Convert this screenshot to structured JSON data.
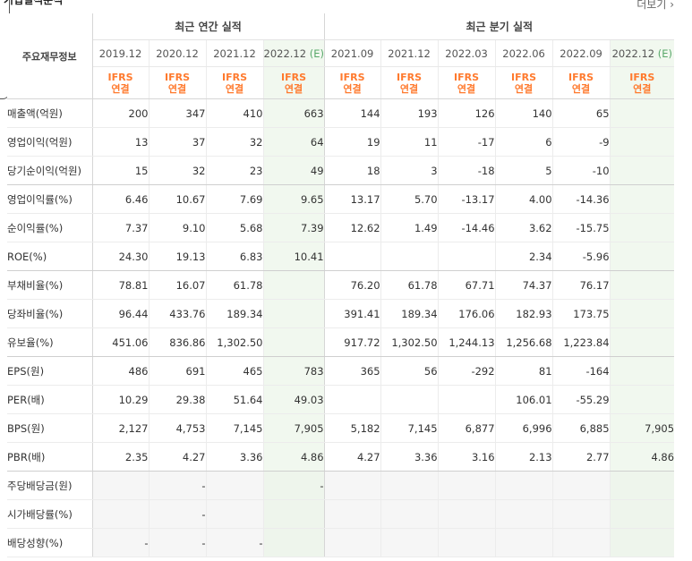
{
  "header": {
    "title": "기업실적분석",
    "more": "더보기",
    "item_header": "주요재무정보",
    "annual_header": "최근 연간 실적",
    "quarter_header": "최근 분기 실적",
    "estimate_mark": "(E)"
  },
  "periods": [
    {
      "date": "2019.12",
      "est": false,
      "l1": "IFRS",
      "l2": "연결"
    },
    {
      "date": "2020.12",
      "est": false,
      "l1": "IFRS",
      "l2": "연결"
    },
    {
      "date": "2021.12",
      "est": false,
      "l1": "IFRS",
      "l2": "연결"
    },
    {
      "date": "2022.12",
      "est": true,
      "l1": "IFRS",
      "l2": "연결"
    },
    {
      "date": "2021.09",
      "est": false,
      "l1": "IFRS",
      "l2": "연결"
    },
    {
      "date": "2021.12",
      "est": false,
      "l1": "IFRS",
      "l2": "연결"
    },
    {
      "date": "2022.03",
      "est": false,
      "l1": "IFRS",
      "l2": "연결"
    },
    {
      "date": "2022.06",
      "est": false,
      "l1": "IFRS",
      "l2": "연결"
    },
    {
      "date": "2022.09",
      "est": false,
      "l1": "IFRS",
      "l2": "연결"
    },
    {
      "date": "2022.12",
      "est": true,
      "l1": "IFRS",
      "l2": "연결"
    }
  ],
  "rows": [
    {
      "label": "매출액(억원)",
      "values": [
        "200",
        "347",
        "410",
        "663",
        "144",
        "193",
        "126",
        "140",
        "65",
        ""
      ]
    },
    {
      "label": "영업이익(억원)",
      "values": [
        "13",
        "37",
        "32",
        "64",
        "19",
        "11",
        "-17",
        "6",
        "-9",
        ""
      ]
    },
    {
      "label": "당기순이익(억원)",
      "values": [
        "15",
        "32",
        "23",
        "49",
        "18",
        "3",
        "-18",
        "5",
        "-10",
        ""
      ],
      "group_end": true
    },
    {
      "label": "영업이익률(%)",
      "values": [
        "6.46",
        "10.67",
        "7.69",
        "9.65",
        "13.17",
        "5.70",
        "-13.17",
        "4.00",
        "-14.36",
        ""
      ]
    },
    {
      "label": "순이익률(%)",
      "values": [
        "7.37",
        "9.10",
        "5.68",
        "7.39",
        "12.62",
        "1.49",
        "-14.46",
        "3.62",
        "-15.75",
        ""
      ]
    },
    {
      "label": "ROE(%)",
      "values": [
        "24.30",
        "19.13",
        "6.83",
        "10.41",
        "",
        "",
        "",
        "2.34",
        "-5.96",
        ""
      ],
      "group_end": true
    },
    {
      "label": "부채비율(%)",
      "values": [
        "78.81",
        "16.07",
        "61.78",
        "",
        "76.20",
        "61.78",
        "67.71",
        "74.37",
        "76.17",
        ""
      ]
    },
    {
      "label": "당좌비율(%)",
      "values": [
        "96.44",
        "433.76",
        "189.34",
        "",
        "391.41",
        "189.34",
        "176.06",
        "182.93",
        "173.75",
        ""
      ]
    },
    {
      "label": "유보율(%)",
      "values": [
        "451.06",
        "836.86",
        "1,302.50",
        "",
        "917.72",
        "1,302.50",
        "1,244.13",
        "1,256.68",
        "1,223.84",
        ""
      ],
      "group_end": true
    },
    {
      "label": "EPS(원)",
      "values": [
        "486",
        "691",
        "465",
        "783",
        "365",
        "56",
        "-292",
        "81",
        "-164",
        ""
      ]
    },
    {
      "label": "PER(배)",
      "values": [
        "10.29",
        "29.38",
        "51.64",
        "49.03",
        "",
        "",
        "",
        "106.01",
        "-55.29",
        ""
      ]
    },
    {
      "label": "BPS(원)",
      "values": [
        "2,127",
        "4,753",
        "7,145",
        "7,905",
        "5,182",
        "7,145",
        "6,877",
        "6,996",
        "6,885",
        "7,905"
      ]
    },
    {
      "label": "PBR(배)",
      "values": [
        "2.35",
        "4.27",
        "3.36",
        "4.86",
        "4.27",
        "3.36",
        "3.16",
        "2.13",
        "2.77",
        "4.86"
      ],
      "group_end": true
    },
    {
      "label": "주당배당금(원)",
      "values": [
        "",
        "-",
        "",
        "-",
        "",
        "",
        "",
        "",
        "",
        ""
      ],
      "empty": true
    },
    {
      "label": "시가배당률(%)",
      "values": [
        "",
        "-",
        "",
        "",
        "",
        "",
        "",
        "",
        "",
        ""
      ],
      "empty": true
    },
    {
      "label": "배당성향(%)",
      "values": [
        "-",
        "-",
        "-",
        "",
        "",
        "",
        "",
        "",
        "",
        ""
      ],
      "empty": true
    }
  ]
}
